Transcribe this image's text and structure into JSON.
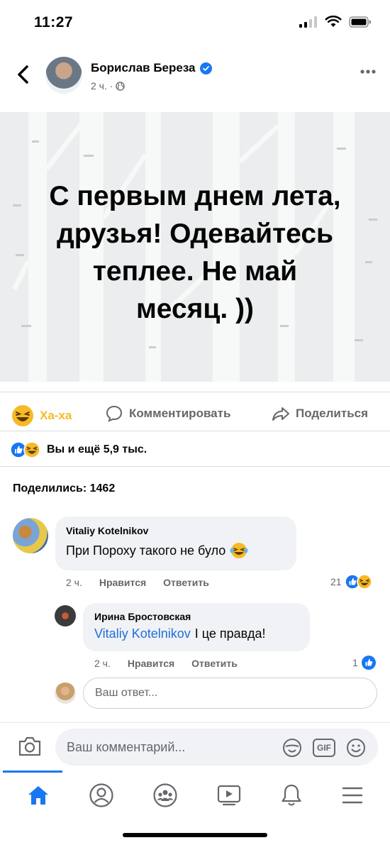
{
  "status_bar": {
    "time": "11:27"
  },
  "header": {
    "author": "Борислав Береза",
    "time": "2 ч. ·"
  },
  "post": {
    "lines": [
      "С первым днем лета,",
      "друзья! Одевайтесь",
      "теплее. Не май",
      "месяц. ))"
    ]
  },
  "actions": {
    "haha_label": "Ха-ха",
    "comment_label": "Комментировать",
    "share_label": "Поделиться"
  },
  "reactions": {
    "summary": "Вы и ещё 5,9 тыс."
  },
  "shares": {
    "label": "Поделились: 1462"
  },
  "comments": [
    {
      "author": "Vitaliy Kotelnikov",
      "text": "При Пороху такого не було",
      "time": "2 ч.",
      "like_label": "Нравится",
      "reply_label": "Ответить",
      "reaction_count": "21"
    },
    {
      "author": "Ирина Бростовская",
      "mention": "Vitaliy Kotelnikov",
      "text": "І це правда!",
      "time": "2 ч.",
      "like_label": "Нравится",
      "reply_label": "Ответить",
      "reaction_count": "1"
    }
  ],
  "reply_box": {
    "placeholder": "Ваш ответ..."
  },
  "composer": {
    "placeholder": "Ваш комментарий...",
    "gif_label": "GIF"
  },
  "tabs": [
    "home-icon",
    "profile-icon",
    "groups-icon",
    "watch-icon",
    "notifications-icon",
    "menu-icon"
  ],
  "colors": {
    "accent": "#1877f2",
    "haha": "#f7b928",
    "secondary_text": "#65676b"
  }
}
